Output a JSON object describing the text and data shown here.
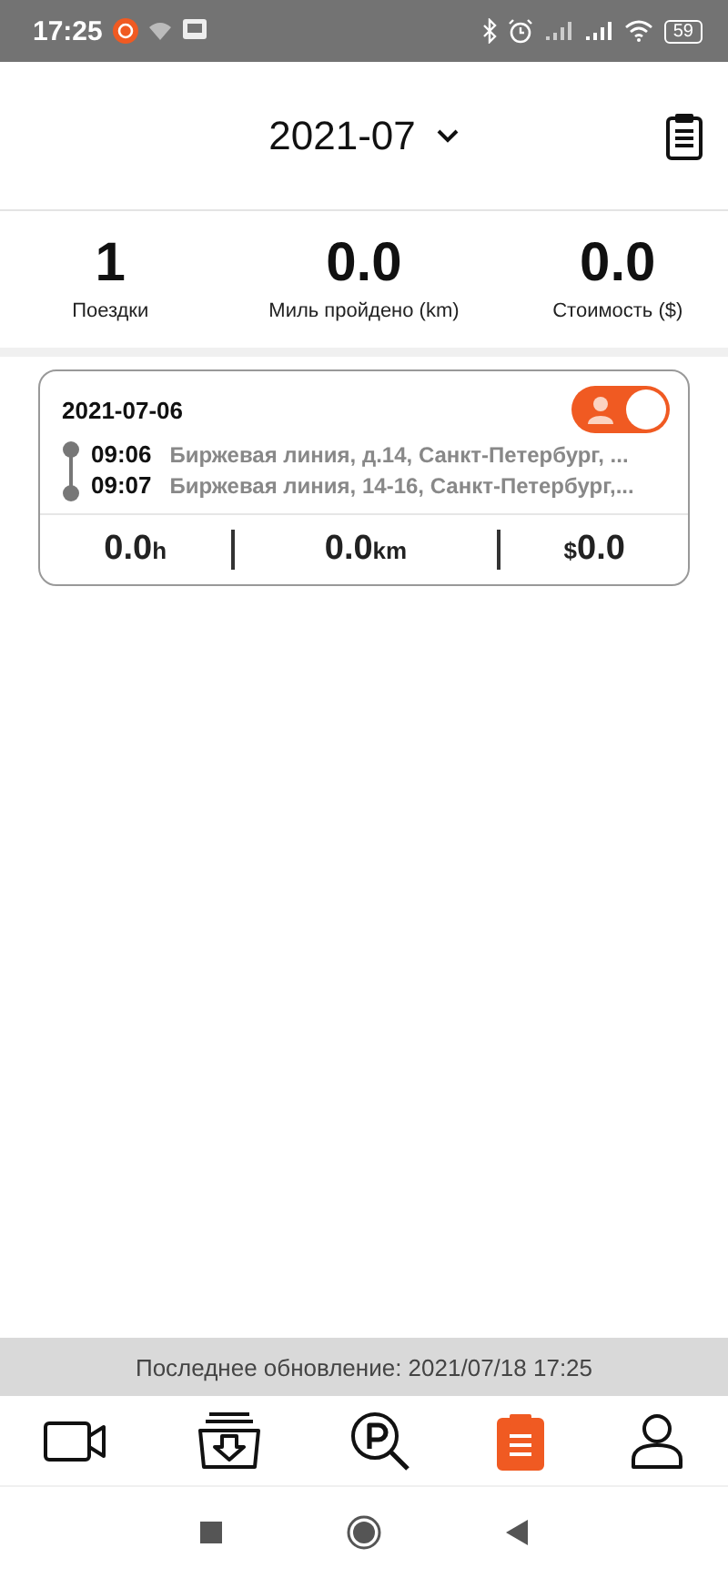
{
  "status_bar": {
    "time": "17:25",
    "battery": "59"
  },
  "header": {
    "month": "2021-07"
  },
  "stats": [
    {
      "value": "1",
      "label": "Поездки"
    },
    {
      "value": "0.0",
      "label": "Миль пройдено (km)"
    },
    {
      "value": "0.0",
      "label": "Стоимость ($)"
    }
  ],
  "trips": [
    {
      "date": "2021-07-06",
      "private": true,
      "stops": [
        {
          "time": "09:06",
          "address": "Биржевая линия, д.14, Санкт-Петербург, ..."
        },
        {
          "time": "09:07",
          "address": "Биржевая линия, 14-16, Санкт-Петербург,..."
        }
      ],
      "totals": [
        {
          "kind": "suffix",
          "value": "0.0",
          "unit": "h"
        },
        {
          "kind": "suffix",
          "value": "0.0",
          "unit": "km"
        },
        {
          "kind": "prefix",
          "value": "0.0",
          "unit": "$"
        }
      ]
    }
  ],
  "last_update": "Последнее обновление: 2021/07/18 17:25",
  "nav": [
    {
      "kind": "video",
      "selected": false
    },
    {
      "kind": "download",
      "selected": false
    },
    {
      "kind": "parking",
      "selected": false
    },
    {
      "kind": "trips",
      "selected": true
    },
    {
      "kind": "profile",
      "selected": false
    }
  ]
}
